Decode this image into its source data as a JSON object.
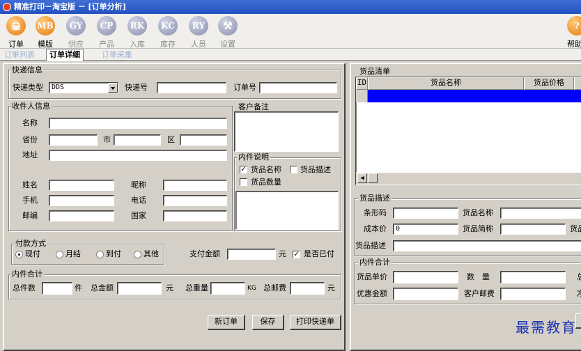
{
  "window": {
    "title": "精准打印－淘宝版 － [订单分析]"
  },
  "toolbar": {
    "items": [
      {
        "icon": "🖨",
        "label": "订单",
        "active": true
      },
      {
        "icon": "MB",
        "label": "模版",
        "active": true
      },
      {
        "icon": "GY",
        "label": "供应",
        "active": false
      },
      {
        "icon": "CP",
        "label": "产品",
        "active": false
      },
      {
        "icon": "RK",
        "label": "入库",
        "active": false
      },
      {
        "icon": "KC",
        "label": "库存",
        "active": false
      },
      {
        "icon": "RY",
        "label": "人员",
        "active": false
      },
      {
        "icon": "⚒",
        "label": "设置",
        "active": false
      }
    ],
    "help_icon": "?",
    "help_label": "帮助"
  },
  "tabs": {
    "list": "订单列表",
    "detail": "订单详细",
    "collect": "订单采集"
  },
  "express": {
    "legend": "快递信息",
    "type_label": "快递类型",
    "type_value": "DDS",
    "no_label": "快递号",
    "no_value": "",
    "order_label": "订单号",
    "order_value": ""
  },
  "receiver": {
    "legend": "收件人信息",
    "name": "名称",
    "province": "省份",
    "city": "市",
    "district": "区",
    "address": "地址",
    "person": "姓名",
    "nickname": "昵称",
    "mobile": "手机",
    "phone": "电话",
    "zip": "邮编",
    "country": "国家"
  },
  "customer_note": {
    "legend": "客户备注"
  },
  "contents_note": {
    "legend": "内件说明",
    "opt_name": "货品名称",
    "opt_desc": "货品描述",
    "opt_qty": "货品数量"
  },
  "payment": {
    "legend": "付款方式",
    "cash": "现付",
    "monthly": "月结",
    "cod": "到付",
    "other": "其他",
    "amount_label": "支付金额",
    "unit": "元",
    "paid_label": "是否已付"
  },
  "totals": {
    "legend": "内件合计",
    "count_label": "总件数",
    "count_unit": "件",
    "amount_label": "总金额",
    "amount_unit": "元",
    "weight_label": "总重量",
    "weight_unit": "KG",
    "postage_label": "总邮费",
    "postage_unit": "元"
  },
  "buttons": {
    "new_order": "新订单",
    "save": "保存",
    "print": "打印快递单"
  },
  "goods_list": {
    "legend": "货品清单",
    "col_id": "ID",
    "col_name": "货品名称",
    "col_price": "货品价格"
  },
  "goods_desc": {
    "legend": "货品描述",
    "barcode": "条形码",
    "name": "货品名称",
    "cost": "成本价",
    "cost_value": "0",
    "short": "货品简称",
    "short2": "货品",
    "desc": "货品描述"
  },
  "inner_total": {
    "legend": "内件合计",
    "unit_price": "货品单价",
    "qty": "数　量",
    "qty_right": "总",
    "discount": "优惠金额",
    "postage": "客户邮费",
    "net": "净"
  },
  "watermark": "最需教育"
}
